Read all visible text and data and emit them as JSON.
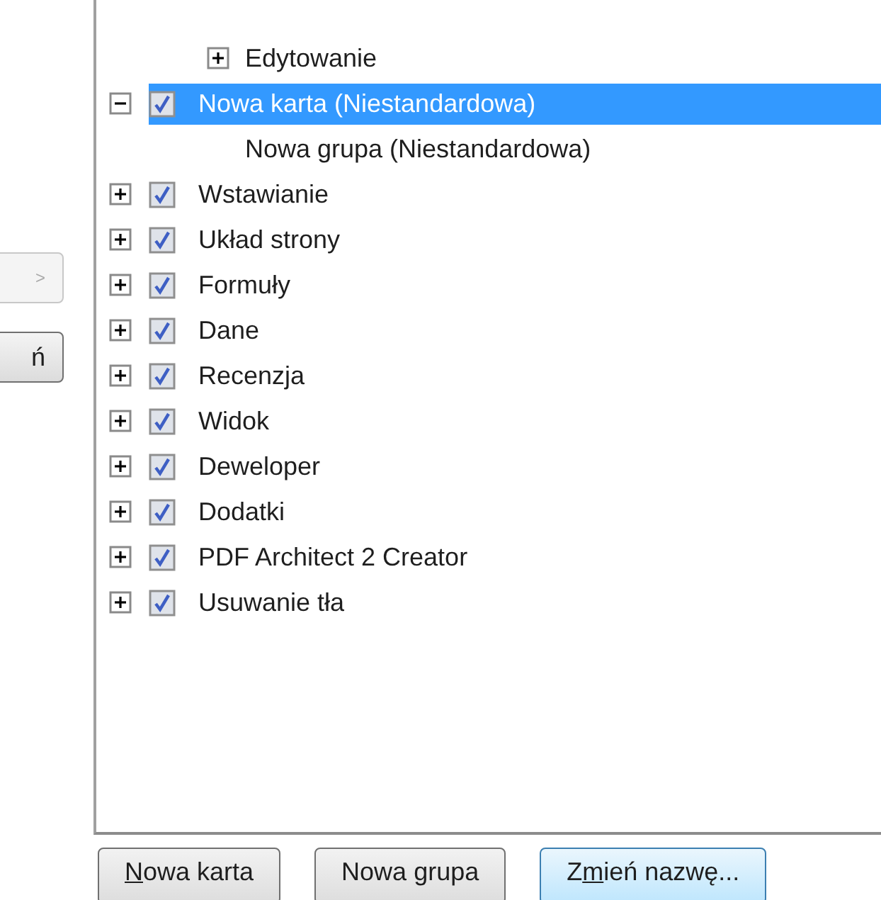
{
  "side_buttons": [
    {
      "label": ">",
      "disabled": true
    },
    {
      "label": "ń",
      "disabled": false
    }
  ],
  "tree": [
    {
      "label": "Edytowanie",
      "kind": "group",
      "expanded": false,
      "selected": false
    },
    {
      "label": "Nowa karta (Niestandardowa)",
      "kind": "tab",
      "checked": true,
      "expanded": true,
      "selected": true,
      "children": [
        {
          "label": "Nowa grupa (Niestandardowa)",
          "kind": "group",
          "selected": false
        }
      ]
    },
    {
      "label": "Wstawianie",
      "kind": "tab",
      "checked": true,
      "expanded": false,
      "selected": false
    },
    {
      "label": "Układ strony",
      "kind": "tab",
      "checked": true,
      "expanded": false,
      "selected": false
    },
    {
      "label": "Formuły",
      "kind": "tab",
      "checked": true,
      "expanded": false,
      "selected": false
    },
    {
      "label": "Dane",
      "kind": "tab",
      "checked": true,
      "expanded": false,
      "selected": false
    },
    {
      "label": "Recenzja",
      "kind": "tab",
      "checked": true,
      "expanded": false,
      "selected": false
    },
    {
      "label": "Widok",
      "kind": "tab",
      "checked": true,
      "expanded": false,
      "selected": false
    },
    {
      "label": "Deweloper",
      "kind": "tab",
      "checked": true,
      "expanded": false,
      "selected": false
    },
    {
      "label": "Dodatki",
      "kind": "tab",
      "checked": true,
      "expanded": false,
      "selected": false
    },
    {
      "label": "PDF Architect 2 Creator",
      "kind": "tab",
      "checked": true,
      "expanded": false,
      "selected": false
    },
    {
      "label": "Usuwanie tła",
      "kind": "tab",
      "checked": true,
      "expanded": false,
      "selected": false
    }
  ],
  "buttons": [
    {
      "access_key": "N",
      "after": "owa karta",
      "focused": false
    },
    {
      "before": "Nowa ",
      "access_key": "g",
      "after": "rupa",
      "focused": false
    },
    {
      "before": "Z",
      "access_key": "m",
      "after": "ień nazwę...",
      "focused": true
    }
  ]
}
